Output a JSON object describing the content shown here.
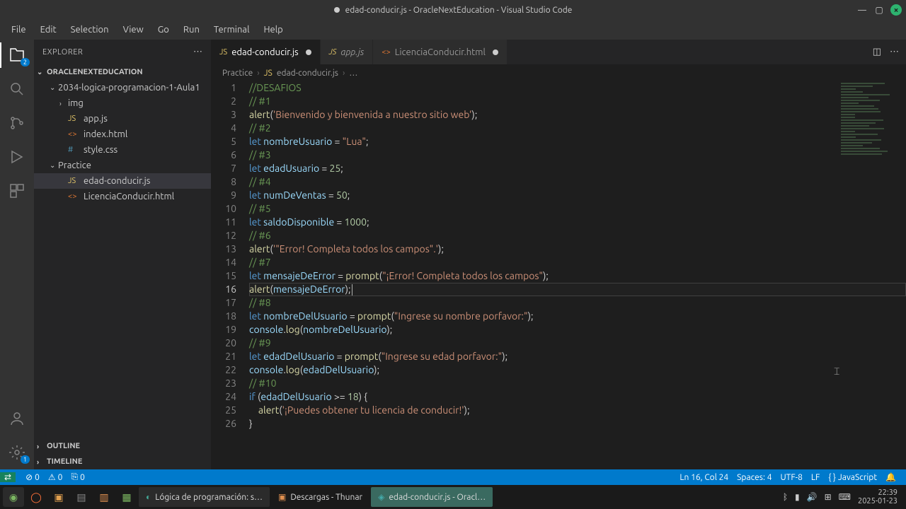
{
  "window": {
    "title": "edad-conducir.js - OracleNextEducation - Visual Studio Code"
  },
  "menu": [
    "File",
    "Edit",
    "Selection",
    "View",
    "Go",
    "Run",
    "Terminal",
    "Help"
  ],
  "activity_badge": "2",
  "settings_badge": "1",
  "explorer": {
    "title": "EXPLORER",
    "project": "ORACLENEXTEDUCATION",
    "tree": [
      {
        "indent": 1,
        "chev": "⌄",
        "icon": "",
        "label": "2034-logica-programacion-1-Aula1",
        "selected": false
      },
      {
        "indent": 2,
        "chev": "›",
        "icon": "",
        "label": "img"
      },
      {
        "indent": 2,
        "chev": "",
        "icon": "JS",
        "iconClass": "js",
        "label": "app.js"
      },
      {
        "indent": 2,
        "chev": "",
        "icon": "<>",
        "iconClass": "html",
        "label": "index.html"
      },
      {
        "indent": 2,
        "chev": "",
        "icon": "#",
        "iconClass": "css",
        "label": "style.css"
      },
      {
        "indent": 1,
        "chev": "⌄",
        "icon": "",
        "label": "Practice"
      },
      {
        "indent": 2,
        "chev": "",
        "icon": "JS",
        "iconClass": "js",
        "label": "edad-conducir.js",
        "selected": true
      },
      {
        "indent": 2,
        "chev": "",
        "icon": "<>",
        "iconClass": "html",
        "label": "LicenciaConducir.html"
      }
    ],
    "sections": [
      "OUTLINE",
      "TIMELINE"
    ]
  },
  "tabs": [
    {
      "icon": "JS",
      "iconClass": "js",
      "label": "edad-conducir.js",
      "active": true,
      "modified": true
    },
    {
      "icon": "JS",
      "iconClass": "js",
      "label": "app.js",
      "active": false,
      "modified": false,
      "dim": true
    },
    {
      "icon": "<>",
      "iconClass": "html",
      "label": "LicenciaConducir.html",
      "active": false,
      "modified": true
    }
  ],
  "breadcrumbs": [
    "Practice",
    "edad-conducir.js",
    "…"
  ],
  "code": {
    "current_line": 16,
    "lines": [
      [
        {
          "t": "comment",
          "v": "//DESAFIOS"
        }
      ],
      [
        {
          "t": "comment",
          "v": "// #1"
        }
      ],
      [
        {
          "t": "fn",
          "v": "alert"
        },
        {
          "t": "punc",
          "v": "("
        },
        {
          "t": "str",
          "v": "'Bienvenido y bienvenida a nuestro sitio web'"
        },
        {
          "t": "punc",
          "v": ");"
        }
      ],
      [
        {
          "t": "comment",
          "v": "// #2"
        }
      ],
      [
        {
          "t": "key",
          "v": "let"
        },
        {
          "t": "punc",
          "v": " "
        },
        {
          "t": "var",
          "v": "nombreUsuario"
        },
        {
          "t": "punc",
          "v": " = "
        },
        {
          "t": "str",
          "v": "\"Lua\""
        },
        {
          "t": "punc",
          "v": ";"
        }
      ],
      [
        {
          "t": "comment",
          "v": "// #3"
        }
      ],
      [
        {
          "t": "key",
          "v": "let"
        },
        {
          "t": "punc",
          "v": " "
        },
        {
          "t": "var",
          "v": "edadUsuario"
        },
        {
          "t": "punc",
          "v": " = "
        },
        {
          "t": "num",
          "v": "25"
        },
        {
          "t": "punc",
          "v": ";"
        }
      ],
      [
        {
          "t": "comment",
          "v": "// #4"
        }
      ],
      [
        {
          "t": "key",
          "v": "let"
        },
        {
          "t": "punc",
          "v": " "
        },
        {
          "t": "var",
          "v": "numDeVentas"
        },
        {
          "t": "punc",
          "v": " = "
        },
        {
          "t": "num",
          "v": "50"
        },
        {
          "t": "punc",
          "v": ";"
        }
      ],
      [
        {
          "t": "comment",
          "v": "// #5"
        }
      ],
      [
        {
          "t": "key",
          "v": "let"
        },
        {
          "t": "punc",
          "v": " "
        },
        {
          "t": "var",
          "v": "saldoDisponible"
        },
        {
          "t": "punc",
          "v": " = "
        },
        {
          "t": "num",
          "v": "1000"
        },
        {
          "t": "punc",
          "v": ";"
        }
      ],
      [
        {
          "t": "comment",
          "v": "// #6"
        }
      ],
      [
        {
          "t": "fn",
          "v": "alert"
        },
        {
          "t": "punc",
          "v": "("
        },
        {
          "t": "str",
          "v": "'\"Error! Completa todos los campos\".'"
        },
        {
          "t": "punc",
          "v": ");"
        }
      ],
      [
        {
          "t": "comment",
          "v": "// #7"
        }
      ],
      [
        {
          "t": "key",
          "v": "let"
        },
        {
          "t": "punc",
          "v": " "
        },
        {
          "t": "var",
          "v": "mensajeDeError"
        },
        {
          "t": "punc",
          "v": " = "
        },
        {
          "t": "fn",
          "v": "prompt"
        },
        {
          "t": "punc",
          "v": "("
        },
        {
          "t": "str",
          "v": "\"¡Error! Completa todos los campos\""
        },
        {
          "t": "punc",
          "v": ");"
        }
      ],
      [
        {
          "t": "fn",
          "v": "alert"
        },
        {
          "t": "punc",
          "v": "("
        },
        {
          "t": "var",
          "v": "mensajeDeError"
        },
        {
          "t": "punc",
          "v": ");"
        },
        {
          "t": "cursor",
          "v": ""
        }
      ],
      [
        {
          "t": "comment",
          "v": "// #8"
        }
      ],
      [
        {
          "t": "key",
          "v": "let"
        },
        {
          "t": "punc",
          "v": " "
        },
        {
          "t": "var",
          "v": "nombreDelUsuario"
        },
        {
          "t": "punc",
          "v": " = "
        },
        {
          "t": "fn",
          "v": "prompt"
        },
        {
          "t": "punc",
          "v": "("
        },
        {
          "t": "str",
          "v": "\"Ingrese su nombre porfavor:\""
        },
        {
          "t": "punc",
          "v": ");"
        }
      ],
      [
        {
          "t": "obj",
          "v": "console"
        },
        {
          "t": "punc",
          "v": "."
        },
        {
          "t": "fn",
          "v": "log"
        },
        {
          "t": "punc",
          "v": "("
        },
        {
          "t": "var",
          "v": "nombreDelUsuario"
        },
        {
          "t": "punc",
          "v": ");"
        }
      ],
      [
        {
          "t": "comment",
          "v": "// #9"
        }
      ],
      [
        {
          "t": "key",
          "v": "let"
        },
        {
          "t": "punc",
          "v": " "
        },
        {
          "t": "var",
          "v": "edadDelUsuario"
        },
        {
          "t": "punc",
          "v": " = "
        },
        {
          "t": "fn",
          "v": "prompt"
        },
        {
          "t": "punc",
          "v": "("
        },
        {
          "t": "str",
          "v": "\"Ingrese su edad porfavor:\""
        },
        {
          "t": "punc",
          "v": ");"
        }
      ],
      [
        {
          "t": "obj",
          "v": "console"
        },
        {
          "t": "punc",
          "v": "."
        },
        {
          "t": "fn",
          "v": "log"
        },
        {
          "t": "punc",
          "v": "("
        },
        {
          "t": "var",
          "v": "edadDelUsuario"
        },
        {
          "t": "punc",
          "v": ");"
        }
      ],
      [
        {
          "t": "comment",
          "v": "// #10"
        }
      ],
      [
        {
          "t": "key",
          "v": "if"
        },
        {
          "t": "punc",
          "v": " ("
        },
        {
          "t": "var",
          "v": "edadDelUsuario"
        },
        {
          "t": "punc",
          "v": " >= "
        },
        {
          "t": "num",
          "v": "18"
        },
        {
          "t": "punc",
          "v": ") {"
        }
      ],
      [
        {
          "t": "punc",
          "v": "    "
        },
        {
          "t": "fn",
          "v": "alert"
        },
        {
          "t": "punc",
          "v": "("
        },
        {
          "t": "str",
          "v": "'¡Puedes obtener tu licencia de conducir!'"
        },
        {
          "t": "punc",
          "v": ");"
        }
      ],
      [
        {
          "t": "punc",
          "v": "}"
        }
      ]
    ]
  },
  "status": {
    "errors": "0",
    "warnings": "0",
    "ports": "0",
    "position": "Ln 16, Col 24",
    "spaces": "Spaces: 4",
    "encoding": "UTF-8",
    "eol": "LF",
    "lang": "JavaScript"
  },
  "taskbar": {
    "browser": "Lógica de programación: s…",
    "files": "Descargas - Thunar",
    "vscode": "edad-conducir.js - Oracl…",
    "time": "22:39",
    "date": "2025-01-23"
  }
}
